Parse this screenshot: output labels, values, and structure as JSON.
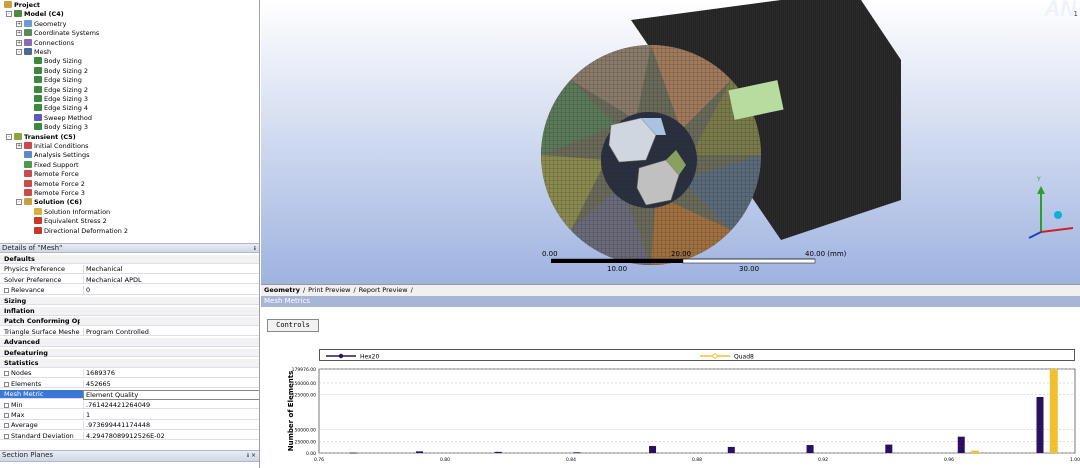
{
  "tree": [
    {
      "label": "Project",
      "bold": true,
      "indent": 0,
      "color": "#c8a040"
    },
    {
      "label": "Model (C4)",
      "bold": true,
      "indent": 1,
      "color": "#4a8c3a",
      "toggle": "-"
    },
    {
      "label": "Geometry",
      "indent": 2,
      "color": "#6a9cd8",
      "toggle": "+"
    },
    {
      "label": "Coordinate Systems",
      "indent": 2,
      "color": "#5a8a5a",
      "toggle": "+"
    },
    {
      "label": "Connections",
      "indent": 2,
      "color": "#8a6ab8",
      "toggle": "+"
    },
    {
      "label": "Mesh",
      "indent": 2,
      "color": "#4a6a9a",
      "toggle": "-"
    },
    {
      "label": "Body Sizing",
      "indent": 3,
      "color": "#3a8a3a"
    },
    {
      "label": "Body Sizing 2",
      "indent": 3,
      "color": "#3a8a3a"
    },
    {
      "label": "Edge Sizing",
      "indent": 3,
      "color": "#3a8a3a"
    },
    {
      "label": "Edge Sizing 2",
      "indent": 3,
      "color": "#3a8a3a"
    },
    {
      "label": "Edge Sizing 3",
      "indent": 3,
      "color": "#3a8a3a"
    },
    {
      "label": "Edge Sizing 4",
      "indent": 3,
      "color": "#3a8a3a"
    },
    {
      "label": "Sweep Method",
      "indent": 3,
      "color": "#5a5ab8"
    },
    {
      "label": "Body Sizing 3",
      "indent": 3,
      "color": "#3a8a3a"
    },
    {
      "label": "Transient (C5)",
      "bold": true,
      "indent": 1,
      "color": "#8aa83a",
      "toggle": "-"
    },
    {
      "label": "Initial Conditions",
      "indent": 2,
      "color": "#c84a4a",
      "toggle": "+"
    },
    {
      "label": "Analysis Settings",
      "indent": 2,
      "color": "#5a8ac8"
    },
    {
      "label": "Fixed Support",
      "indent": 2,
      "color": "#4a9a4a"
    },
    {
      "label": "Remote Force",
      "indent": 2,
      "color": "#c84a4a"
    },
    {
      "label": "Remote Force 2",
      "indent": 2,
      "color": "#c84a4a"
    },
    {
      "label": "Remote Force 3",
      "indent": 2,
      "color": "#c84a4a"
    },
    {
      "label": "Solution (C6)",
      "bold": true,
      "indent": 2,
      "color": "#c8a040",
      "toggle": "-"
    },
    {
      "label": "Solution Information",
      "indent": 3,
      "color": "#d8b040"
    },
    {
      "label": "Equivalent Stress 2",
      "indent": 3,
      "color": "#c8382a"
    },
    {
      "label": "Directional Deformation 2",
      "indent": 3,
      "color": "#c8382a"
    }
  ],
  "details": {
    "title": "Details of \"Mesh\"",
    "pin": "ᵻ",
    "rows": [
      {
        "type": "hdr",
        "k": "Defaults"
      },
      {
        "k": "Physics Preference",
        "v": "Mechanical"
      },
      {
        "k": "Solver Preference",
        "v": "Mechanical APDL"
      },
      {
        "k": "Relevance",
        "v": "0",
        "cb": true
      },
      {
        "type": "hdr",
        "k": "Sizing"
      },
      {
        "type": "hdr",
        "k": "Inflation"
      },
      {
        "type": "hdr",
        "k": "Patch Conforming Options"
      },
      {
        "k": "Triangle Surface Mesher",
        "v": "Program Controlled"
      },
      {
        "type": "hdr",
        "k": "Advanced"
      },
      {
        "type": "hdr",
        "k": "Defeaturing"
      },
      {
        "type": "hdr",
        "k": "Statistics"
      },
      {
        "k": "Nodes",
        "v": "1689376",
        "cb": true
      },
      {
        "k": "Elements",
        "v": "452665",
        "cb": true
      },
      {
        "k": "Mesh Metric",
        "v": "Element Quality",
        "sel": true
      },
      {
        "k": "Min",
        "v": ".761424421264049",
        "cb": true
      },
      {
        "k": "Max",
        "v": "1",
        "cb": true
      },
      {
        "k": "Average",
        "v": ".973699441174448",
        "cb": true
      },
      {
        "k": "Standard Deviation",
        "v": "4.29478089912526E-02",
        "cb": true
      }
    ]
  },
  "section_planes": {
    "title": "Section Planes",
    "controls": "ᵻ ×"
  },
  "viewport": {
    "brand": "AN",
    "brand_sub": "1",
    "scale_labels": [
      "0.00",
      "20.00",
      "40.00 (mm)"
    ],
    "scale_sub": [
      "10.00",
      "30.00"
    ]
  },
  "tabs": [
    "Geometry",
    "Print Preview",
    "Report Preview"
  ],
  "mesh_metrics": {
    "title": "Mesh Metrics",
    "controls_label": "Controls"
  },
  "chart_data": {
    "type": "bar",
    "ylabel": "Number of Elements",
    "y_ticks": [
      "0.00",
      "25000.00",
      "50000.00",
      "125000.00",
      "150000.00",
      "179976.00"
    ],
    "x_ticks": [
      "0.76",
      "0.80",
      "0.84",
      "0.88",
      "0.92",
      "0.96",
      "1.00"
    ],
    "ylim": [
      0,
      179976
    ],
    "xlim": [
      0.76,
      1.0
    ],
    "series": [
      {
        "name": "Hex20",
        "color": "#2a1060",
        "x": [
          0.772,
          0.793,
          0.818,
          0.843,
          0.867,
          0.892,
          0.917,
          0.942,
          0.965,
          0.99
        ],
        "values": [
          800,
          3500,
          2500,
          1500,
          15000,
          13000,
          17000,
          18000,
          35000,
          120000
        ]
      },
      {
        "name": "Quad8",
        "color": "#f0c030",
        "x": [
          0.967,
          0.992
        ],
        "values": [
          5000,
          179976
        ]
      }
    ]
  }
}
